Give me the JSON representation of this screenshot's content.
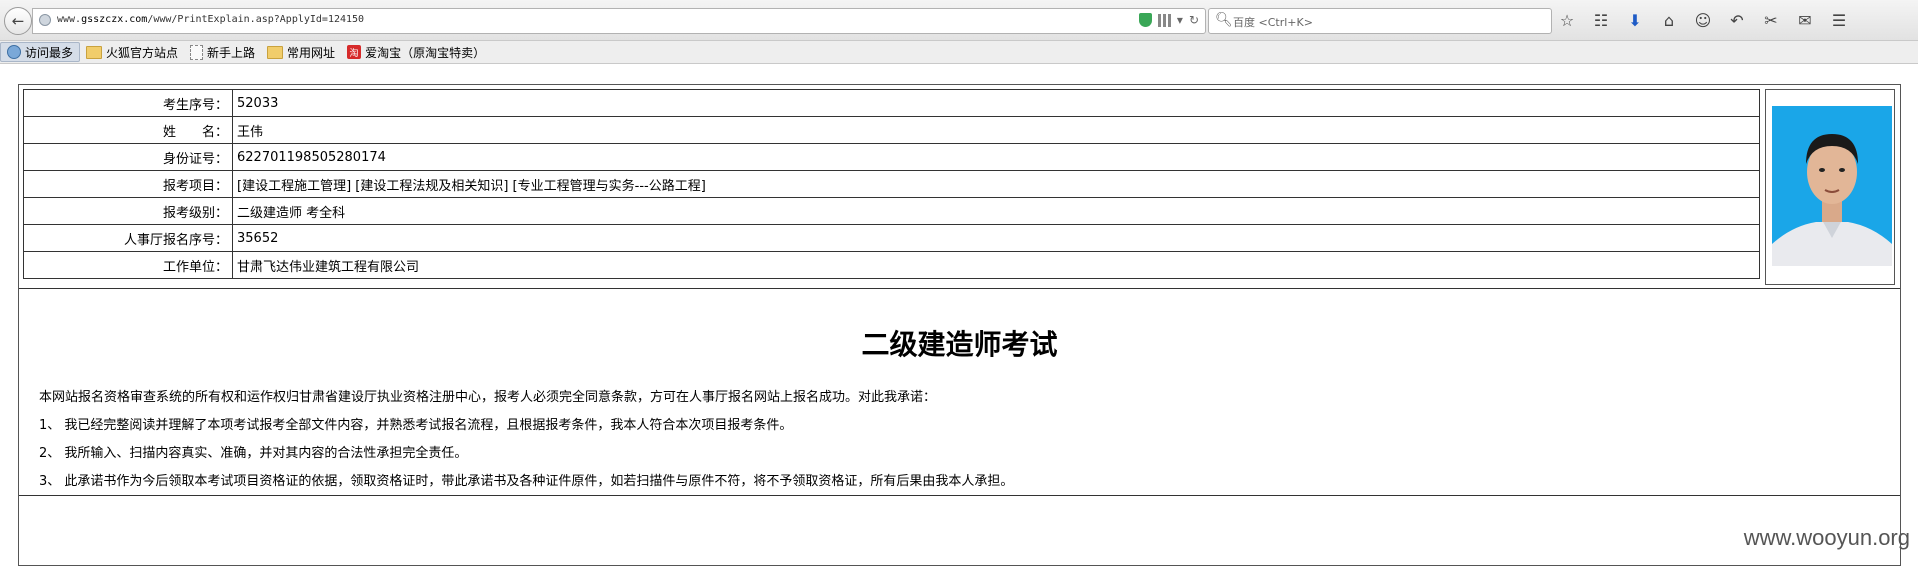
{
  "browser": {
    "url_prefix": "www.",
    "url_host": "gsszczx.com",
    "url_path": "/www/PrintExplain.asp?ApplyId=124150",
    "search_placeholder": "百度 <Ctrl+K>"
  },
  "bookmarks": [
    {
      "label": "访问最多",
      "icon": "magnifier-icon"
    },
    {
      "label": "火狐官方站点",
      "icon": "folder-icon"
    },
    {
      "label": "新手上路",
      "icon": "page-icon"
    },
    {
      "label": "常用网址",
      "icon": "folder-icon"
    },
    {
      "label": "爱淘宝（原淘宝特卖）",
      "icon": "taobao-icon"
    }
  ],
  "info": {
    "rows": [
      {
        "label": "考生序号：",
        "value": "52033"
      },
      {
        "label": "姓　　名：",
        "value": "王伟"
      },
      {
        "label": "身份证号：",
        "value": "622701198505280174"
      },
      {
        "label": "报考项目：",
        "value": "[建设工程施工管理] [建设工程法规及相关知识] [专业工程管理与实务---公路工程]"
      },
      {
        "label": "报考级别：",
        "value": "二级建造师 考全科"
      },
      {
        "label": "人事厅报名序号：",
        "value": "35652"
      },
      {
        "label": "工作单位：",
        "value": "甘肃飞达伟业建筑工程有限公司"
      }
    ]
  },
  "document": {
    "title": "二级建造师考试",
    "paragraphs": [
      "本网站报名资格审查系统的所有权和运作权归甘肃省建设厅执业资格注册中心，报考人必须完全同意条款，方可在人事厅报名网站上报名成功。对此我承诺：",
      "1、 我已经完整阅读并理解了本项考试报考全部文件内容，并熟悉考试报名流程，且根据报考条件，我本人符合本次项目报考条件。",
      "2、 我所输入、扫描内容真实、准确，并对其内容的合法性承担完全责任。",
      "3、 此承诺书作为今后领取本考试项目资格证的依据，领取资格证时，带此承诺书及各种证件原件，如若扫描件与原件不符，将不予领取资格证，所有后果由我本人承担。"
    ]
  },
  "watermark": "www.wooyun.org",
  "colors": {
    "photo_bg": "#1aa6e8",
    "accent_blue": "#1e5bc6"
  }
}
